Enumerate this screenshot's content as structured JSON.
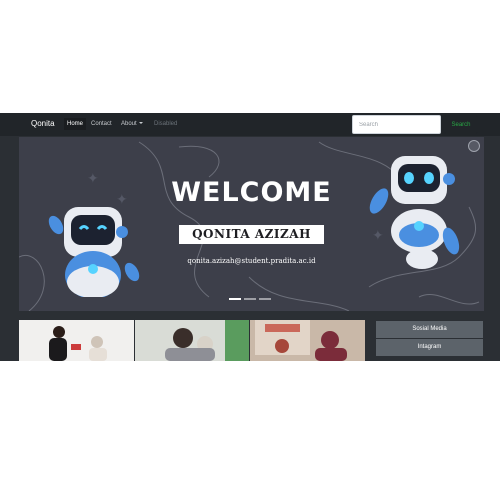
{
  "navbar": {
    "brand": "Qonita",
    "items": [
      {
        "label": "Home",
        "active": true
      },
      {
        "label": "Contact"
      },
      {
        "label": "About"
      },
      {
        "label": "Disabled",
        "disabled": true
      }
    ],
    "search_placeholder": "Search",
    "search_button": "Search"
  },
  "carousel": {
    "title": "WELCOME",
    "name": "QONITA AZIZAH",
    "email": "qonita.azizah@student.pradita.ac.id",
    "active_slide": 1,
    "slide_count": 3
  },
  "sidebar": {
    "buttons": [
      "Sosial Media",
      "Intagram"
    ]
  },
  "colors": {
    "navbar": "#212529",
    "page": "#2b2f34",
    "carousel": "#3d3f4a",
    "accent": "#28a745",
    "robot_blue": "#4a8fe0"
  }
}
